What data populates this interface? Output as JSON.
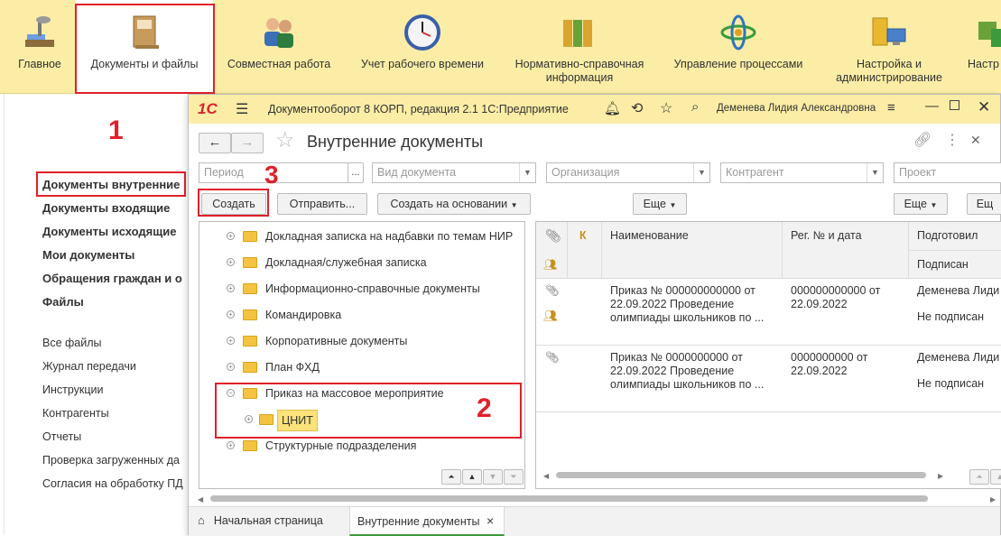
{
  "sections": [
    {
      "label": "Главное",
      "icon": "main-desk-icon"
    },
    {
      "label": "Документы и файлы",
      "icon": "documents-binder-icon",
      "active": true
    },
    {
      "label": "Совместная работа",
      "icon": "users-collaboration-icon"
    },
    {
      "label": "Учет рабочего времени",
      "icon": "clock-icon"
    },
    {
      "label": "Нормативно-справочная информация",
      "icon": "binders-icon"
    },
    {
      "label": "Управление процессами",
      "icon": "process-atom-icon"
    },
    {
      "label": "Настройка и администрирование",
      "icon": "server-computer-icon"
    },
    {
      "label": "Настр",
      "icon": "settings-cubes-icon"
    }
  ],
  "left_nav": {
    "bold_items": [
      "Документы внутренние",
      "Документы входящие",
      "Документы исходящие",
      "Мои документы",
      "Обращения граждан и о",
      "Файлы"
    ],
    "plain_items": [
      "Все файлы",
      "Журнал передачи",
      "Инструкции",
      "Контрагенты",
      "Отчеты",
      "Проверка загруженных да",
      "Согласия на обработку ПД"
    ]
  },
  "annotations": {
    "step1": "1",
    "step2": "2",
    "step3": "3"
  },
  "window": {
    "logo": "1С",
    "app_title": "Документооборот 8 КОРП, редакция 2.1 1С:Предприятие",
    "user": "Деменева Лидия Александровна",
    "form_title": "Внутренние документы"
  },
  "filters": {
    "period": "Период",
    "period_btn": "...",
    "doc_type": "Вид документа",
    "organization": "Организация",
    "counterparty": "Контрагент",
    "project": "Проект"
  },
  "toolbar": {
    "create": "Создать",
    "send": "Отправить...",
    "create_based": "Создать на основании",
    "more1": "Еще",
    "more2": "Еще",
    "more3": "Ещ"
  },
  "tree": [
    {
      "label": "Докладная записка на надбавки по темам НИР",
      "expand": "+",
      "level": 0
    },
    {
      "label": "Докладная/служебная записка",
      "expand": "+",
      "level": 0
    },
    {
      "label": "Информационно-справочные документы",
      "expand": "+",
      "level": 0
    },
    {
      "label": "Командировка",
      "expand": "+",
      "level": 0
    },
    {
      "label": "Корпоративные документы",
      "expand": "+",
      "level": 0
    },
    {
      "label": "План ФХД",
      "expand": "+",
      "level": 0
    },
    {
      "label": "Приказ на массовое мероприятие",
      "expand": "−",
      "level": 0
    },
    {
      "label": "ЦНИТ",
      "expand": "+",
      "level": 1,
      "selected": true
    },
    {
      "label": "Структурные подразделения",
      "expand": "+",
      "level": 0
    }
  ],
  "grid": {
    "headers": {
      "attach": "attachment-icon",
      "k": "К",
      "name": "Наименование",
      "reg": "Рег. № и дата",
      "prepared": "Подготовил",
      "signed": "Подписан"
    },
    "rows": [
      {
        "name": [
          "Приказ № 000000000000 от",
          "22.09.2022 Проведение",
          "олимпиады школьников по ..."
        ],
        "reg": [
          "000000000000 от",
          "22.09.2022"
        ],
        "prepared": "Деменева Лиди",
        "signed": "Не подписан"
      },
      {
        "name": [
          "Приказ № 0000000000 от",
          "22.09.2022 Проведение",
          "олимпиады школьников по ..."
        ],
        "reg": [
          "0000000000 от",
          "22.09.2022"
        ],
        "prepared": "Деменева Лиди",
        "signed": "Не подписан"
      }
    ]
  },
  "bottom_tabs": {
    "home": "Начальная страница",
    "current": "Внутренние документы",
    "close": "×"
  },
  "colors": {
    "accent_yellow": "#fbeda6",
    "annotation_red": "#e0202a",
    "folder": "#f5c342",
    "selected": "#fbe27a"
  }
}
